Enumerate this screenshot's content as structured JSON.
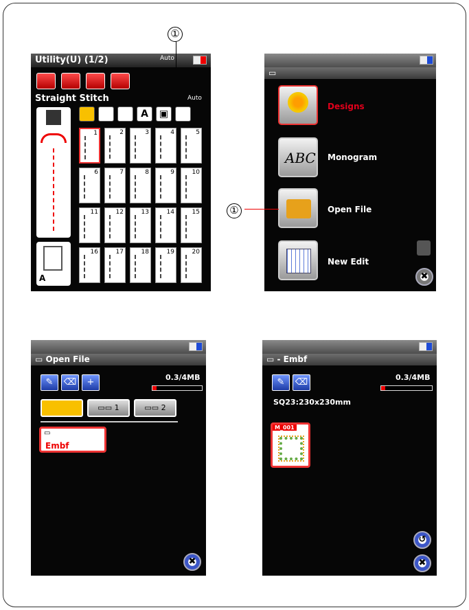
{
  "callout_number": "①",
  "screen1": {
    "title": "Utility(U) (1/2)",
    "auto_label": "Auto",
    "stitch_name": "Straight Stitch",
    "auto2_label": "Auto",
    "tab_letter": "A",
    "foot_letter": "A",
    "cell_numbers": [
      "1",
      "2",
      "3",
      "4",
      "5",
      "6",
      "7",
      "8",
      "9",
      "10",
      "11",
      "12",
      "13",
      "14",
      "15",
      "16",
      "17",
      "18",
      "19",
      "20"
    ]
  },
  "screen2": {
    "menu": [
      {
        "label": "Designs",
        "icon": "flower-design-icon",
        "color": "#e0001b"
      },
      {
        "label": "Monogram",
        "icon": "abc-monogram-icon",
        "color": "#ffffff"
      },
      {
        "label": "Open File",
        "icon": "open-folder-icon",
        "color": "#ffffff"
      },
      {
        "label": "New Edit",
        "icon": "grid-edit-icon",
        "color": "#ffffff"
      }
    ]
  },
  "screen3": {
    "title": "Open File",
    "memory": "0.3/4MB",
    "memory_fraction": 0.08,
    "usb1_label": "1",
    "usb2_label": "2",
    "folder_name": "Embf"
  },
  "screen4": {
    "title": "- Embf",
    "memory": "0.3/4MB",
    "memory_fraction": 0.08,
    "hoop_info": "SQ23:230x230mm",
    "file_name": "M_001"
  }
}
